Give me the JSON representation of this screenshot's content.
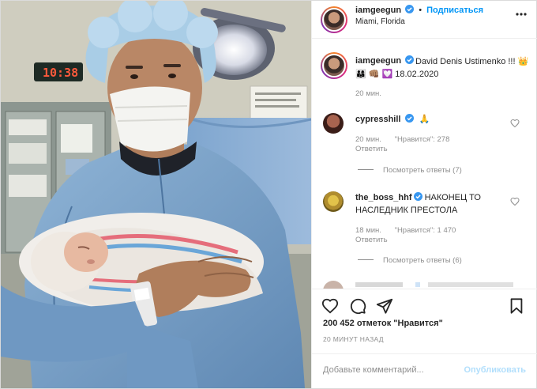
{
  "post": {
    "username": "iamgeegun",
    "follow_label": "Подписаться",
    "separator": "•",
    "location": "Miami, Florida",
    "caption_text": "David Denis Ustimenko !!! 👑 👨‍👩‍👦 👊🏽 💟 18.02.2020",
    "caption_time": "20 мин."
  },
  "comments": [
    {
      "username": "cypresshill",
      "text": "🙏",
      "time": "20 мин.",
      "likes": "\"Нравится\": 278",
      "reply_label": "Ответить",
      "view_replies": "Посмотреть ответы (7)"
    },
    {
      "username": "the_boss_hhf",
      "text": "НАКОНЕЦ ТО НАСЛЕДНИК ПРЕСТОЛА",
      "time": "18 мин.",
      "likes": "\"Нравится\": 1 470",
      "reply_label": "Ответить",
      "view_replies": "Посмотреть ответы (6)"
    }
  ],
  "photo": {
    "clock_text": "10:38"
  },
  "stats": {
    "likes": "200 452 отметок \"Нравится\"",
    "posted_ago": "20 МИНУТ НАЗАД"
  },
  "add_comment": {
    "placeholder": "Добавьте комментарий...",
    "publish_label": "Опубликовать"
  },
  "icons": {
    "heart": "heart-icon",
    "comment": "comment-icon",
    "share": "share-icon",
    "save": "bookmark-icon",
    "more": "more-icon",
    "verified": "verified-icon"
  },
  "colors": {
    "link_blue": "#0095f6",
    "publish_disabled": "#b2dffc",
    "muted": "#8e8e8e",
    "text": "#262626"
  }
}
